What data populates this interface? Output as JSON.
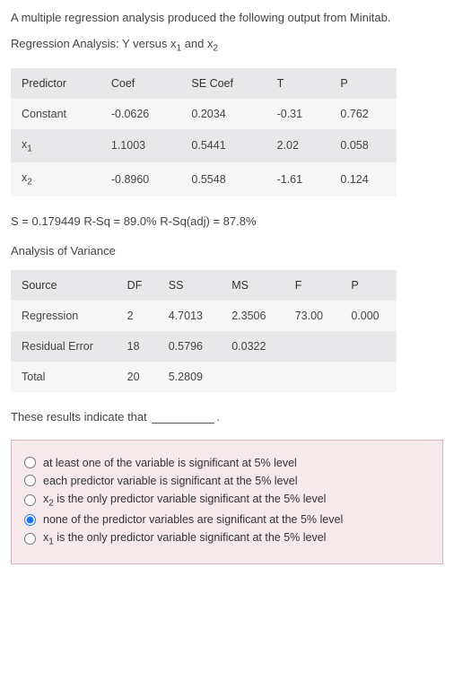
{
  "intro": "A multiple regression analysis produced the following output from Minitab.",
  "title_prefix": "Regression Analysis: Y versus x",
  "title_mid": " and x",
  "coef_headers": [
    "Predictor",
    "Coef",
    "SE Coef",
    "T",
    "P"
  ],
  "coef_rows": [
    {
      "predictor": "Constant",
      "coef": "-0.0626",
      "se": "0.2034",
      "t": "-0.31",
      "p": "0.762"
    },
    {
      "predictor_sub": "1",
      "predictor_pre": "x",
      "coef": "1.1003",
      "se": "0.5441",
      "t": "2.02",
      "p": "0.058"
    },
    {
      "predictor_sub": "2",
      "predictor_pre": "x",
      "coef": "-0.8960",
      "se": "0.5548",
      "t": "-1.61",
      "p": "0.124"
    }
  ],
  "summary": "S = 0.179449    R-Sq = 89.0%    R-Sq(adj) = 87.8%",
  "anova_title": "Analysis of Variance",
  "anova_headers": [
    "Source",
    "DF",
    "SS",
    "MS",
    "F",
    "P"
  ],
  "anova_rows": [
    {
      "source": "Regression",
      "df": "2",
      "ss": "4.7013",
      "ms": "2.3506",
      "f": "73.00",
      "p": "0.000"
    },
    {
      "source": "Residual Error",
      "df": "18",
      "ss": "0.5796",
      "ms": "0.0322",
      "f": "",
      "p": ""
    },
    {
      "source": "Total",
      "df": "20",
      "ss": "5.2809",
      "ms": "",
      "f": "",
      "p": ""
    }
  ],
  "prompt_pre": "These results indicate that ",
  "prompt_post": ".",
  "options": [
    {
      "text": "at least one of the variable is significant at 5% level",
      "checked": false
    },
    {
      "text": "each predictor variable is significant at the 5% level",
      "checked": false
    },
    {
      "text_pre": "x",
      "sub": "2",
      "text_post": " is the only predictor variable significant at the 5% level",
      "checked": false
    },
    {
      "text": "none of the predictor variables are significant at the 5% level",
      "checked": true
    },
    {
      "text_pre": "x",
      "sub": "1",
      "text_post": " is the only predictor variable significant at the 5% level",
      "checked": false
    }
  ],
  "chart_data": {
    "type": "table",
    "coefficient_table": {
      "predictors": [
        "Constant",
        "x1",
        "x2"
      ],
      "coef": [
        -0.0626,
        1.1003,
        -0.896
      ],
      "se_coef": [
        0.2034,
        0.5441,
        0.5548
      ],
      "t": [
        -0.31,
        2.02,
        -1.61
      ],
      "p": [
        0.762,
        0.058,
        0.124
      ]
    },
    "model_summary": {
      "S": 0.179449,
      "R_Sq": 0.89,
      "R_Sq_adj": 0.878
    },
    "anova": {
      "source": [
        "Regression",
        "Residual Error",
        "Total"
      ],
      "df": [
        2,
        18,
        20
      ],
      "ss": [
        4.7013,
        0.5796,
        5.2809
      ],
      "ms": [
        2.3506,
        0.0322,
        null
      ],
      "f": [
        73.0,
        null,
        null
      ],
      "p": [
        0.0,
        null,
        null
      ]
    }
  }
}
